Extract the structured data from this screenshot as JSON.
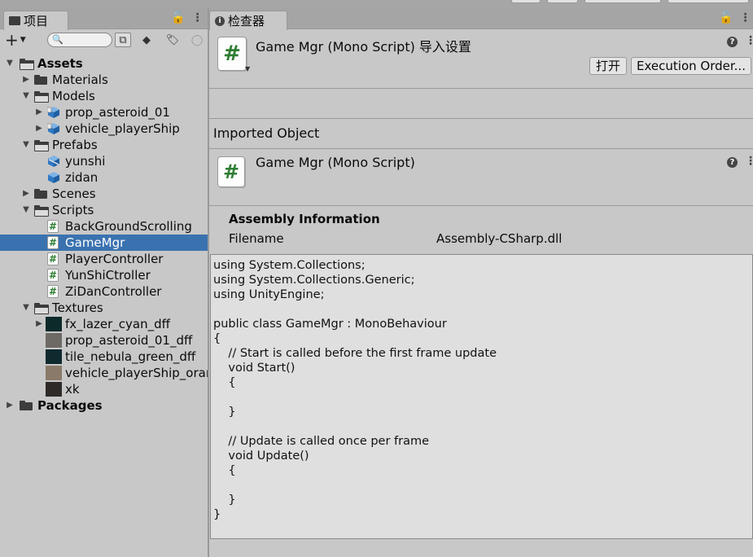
{
  "project_panel": {
    "tab_label": "项目",
    "search_placeholder": "",
    "tree": [
      {
        "label": "Assets",
        "bold": true,
        "icon": "folder-open-icon",
        "arrow": "down",
        "depth": 0
      },
      {
        "label": "Materials",
        "icon": "folder-icon",
        "arrow": "right",
        "depth": 1
      },
      {
        "label": "Models",
        "icon": "folder-open-icon",
        "arrow": "down",
        "depth": 1
      },
      {
        "label": "prop_asteroid_01",
        "icon": "prefab-model-icon",
        "arrow": "right",
        "depth": 2
      },
      {
        "label": "vehicle_playerShip",
        "icon": "prefab-model-icon",
        "arrow": "right",
        "depth": 2
      },
      {
        "label": "Prefabs",
        "icon": "folder-open-icon",
        "arrow": "down",
        "depth": 1
      },
      {
        "label": "yunshi",
        "icon": "prefab-variant-icon",
        "arrow": "",
        "depth": 2
      },
      {
        "label": "zidan",
        "icon": "prefab-icon",
        "arrow": "",
        "depth": 2
      },
      {
        "label": "Scenes",
        "icon": "folder-icon",
        "arrow": "right",
        "depth": 1
      },
      {
        "label": "Scripts",
        "icon": "folder-open-icon",
        "arrow": "down",
        "depth": 1
      },
      {
        "label": "BackGroundScrolling",
        "icon": "csharp-script-icon",
        "arrow": "",
        "depth": 2
      },
      {
        "label": "GameMgr",
        "icon": "csharp-script-icon",
        "arrow": "",
        "depth": 2,
        "selected": true
      },
      {
        "label": "PlayerController",
        "icon": "csharp-script-icon",
        "arrow": "",
        "depth": 2
      },
      {
        "label": "YunShiCtroller",
        "icon": "csharp-script-icon",
        "arrow": "",
        "depth": 2
      },
      {
        "label": "ZiDanController",
        "icon": "csharp-script-icon",
        "arrow": "",
        "depth": 2
      },
      {
        "label": "Textures",
        "icon": "folder-open-icon",
        "arrow": "down",
        "depth": 1
      },
      {
        "label": "fx_lazer_cyan_dff",
        "icon": "texture-thumb-icon",
        "arrow": "right",
        "depth": 2,
        "thumb": "#0d2a2a"
      },
      {
        "label": "prop_asteroid_01_dff",
        "icon": "texture-thumb-icon",
        "arrow": "",
        "depth": 2,
        "thumb": "#6d6a66"
      },
      {
        "label": "tile_nebula_green_dff",
        "icon": "texture-thumb-icon",
        "arrow": "",
        "depth": 2,
        "thumb": "#0f2a2e"
      },
      {
        "label": "vehicle_playerShip_oran",
        "icon": "texture-thumb-icon",
        "arrow": "",
        "depth": 2,
        "thumb": "#8a7a6a"
      },
      {
        "label": "xk",
        "icon": "texture-thumb-icon",
        "arrow": "",
        "depth": 2,
        "thumb": "#2e2a28"
      },
      {
        "label": "Packages",
        "bold": true,
        "icon": "folder-icon",
        "arrow": "right",
        "depth": 0
      }
    ]
  },
  "inspector": {
    "tab_label": "检查器",
    "header_title": "Game Mgr (Mono Script) 导入设置",
    "open_button": "打开",
    "execution_order_button": "Execution Order...",
    "imported_object_label": "Imported Object",
    "object_title": "Game Mgr (Mono Script)",
    "assembly_heading": "Assembly Information",
    "filename_label": "Filename",
    "filename_value": "Assembly-CSharp.dll",
    "code": "using System.Collections;\nusing System.Collections.Generic;\nusing UnityEngine;\n\npublic class GameMgr : MonoBehaviour\n{\n    // Start is called before the first frame update\n    void Start()\n    {\n\n    }\n\n    // Update is called once per frame\n    void Update()\n    {\n\n    }\n}"
  },
  "colors": {
    "selection": "#3a72b0",
    "script_hash": "#2e7d32",
    "panel_bg": "#c8c8c8"
  }
}
